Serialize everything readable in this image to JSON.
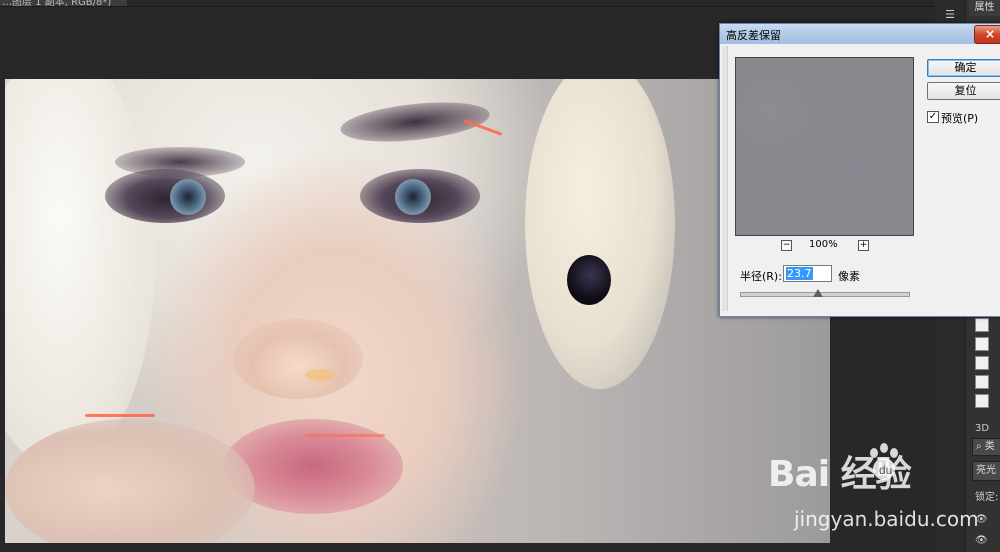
{
  "document_tab": {
    "title": "…图层 1 副本, RGB/8*)"
  },
  "right_panel": {
    "properties_tab": "属性",
    "threeD_label": "3D",
    "search_prefix": "类",
    "dropdown_value": "亮光",
    "lock_label": "锁定:",
    "eye_glyph": "👁"
  },
  "dialog": {
    "title": "高反差保留",
    "close_glyph": "×",
    "ok_button": "确定",
    "reset_button": "复位",
    "preview_label": "预览(P)",
    "preview_checked": true,
    "zoom_minus": "−",
    "zoom_plus": "+",
    "zoom_level": "100%",
    "radius_label": "半径(R):",
    "radius_value": "23.7",
    "radius_unit": "像素",
    "slider_level_fraction": 0.46
  },
  "watermark": {
    "brand": "Bai  经验",
    "url": "jingyan.baidu.com"
  },
  "colors": {
    "workspace_bg": "#282828",
    "dialog_bg": "#f0f0f0",
    "titlebar": "#b3cbe7",
    "close_button": "#d3452b",
    "selection_highlight": "#3399ff"
  }
}
